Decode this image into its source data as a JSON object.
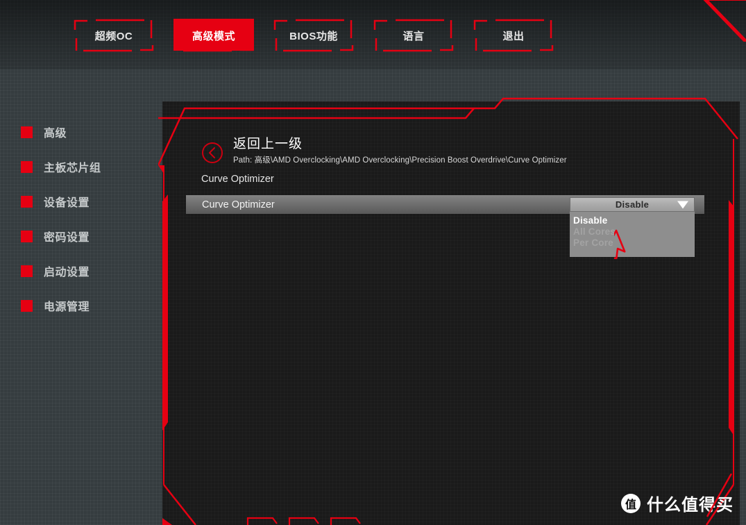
{
  "theme": {
    "accent_red": "#e60012",
    "panel_bg": "#1a1a1a",
    "outer_bg": "#353c3f",
    "text_primary": "#ffffff",
    "text_secondary": "#c6cacb",
    "dropdown_bg": "#8e8e8e",
    "dropdown_button_bg": "#a9a9a9"
  },
  "topbar": {
    "tabs": [
      {
        "label": "超频OC",
        "active": false
      },
      {
        "label": "高级模式",
        "active": true
      },
      {
        "label": "BIOS功能",
        "active": false
      },
      {
        "label": "语言",
        "active": false
      },
      {
        "label": "退出",
        "active": false
      }
    ]
  },
  "sidebar": {
    "items": [
      {
        "label": "高级"
      },
      {
        "label": "主板芯片组"
      },
      {
        "label": "设备设置"
      },
      {
        "label": "密码设置"
      },
      {
        "label": "启动设置"
      },
      {
        "label": "电源管理"
      }
    ]
  },
  "main": {
    "back": {
      "title": "返回上一级",
      "path": "Path: 高级\\AMD Overclocking\\AMD Overclocking\\Precision Boost Overdrive\\Curve Optimizer"
    },
    "section_title": "Curve Optimizer",
    "setting": {
      "label": "Curve Optimizer",
      "value": "Disable"
    },
    "dropdown": {
      "selected": "Disable",
      "options": [
        {
          "label": "Disable",
          "state": "selected"
        },
        {
          "label": "All Cores",
          "state": "disabled"
        },
        {
          "label": "Per Core",
          "state": "disabled"
        }
      ]
    }
  },
  "watermark": {
    "logo_char": "值",
    "text": "什么值得买"
  }
}
